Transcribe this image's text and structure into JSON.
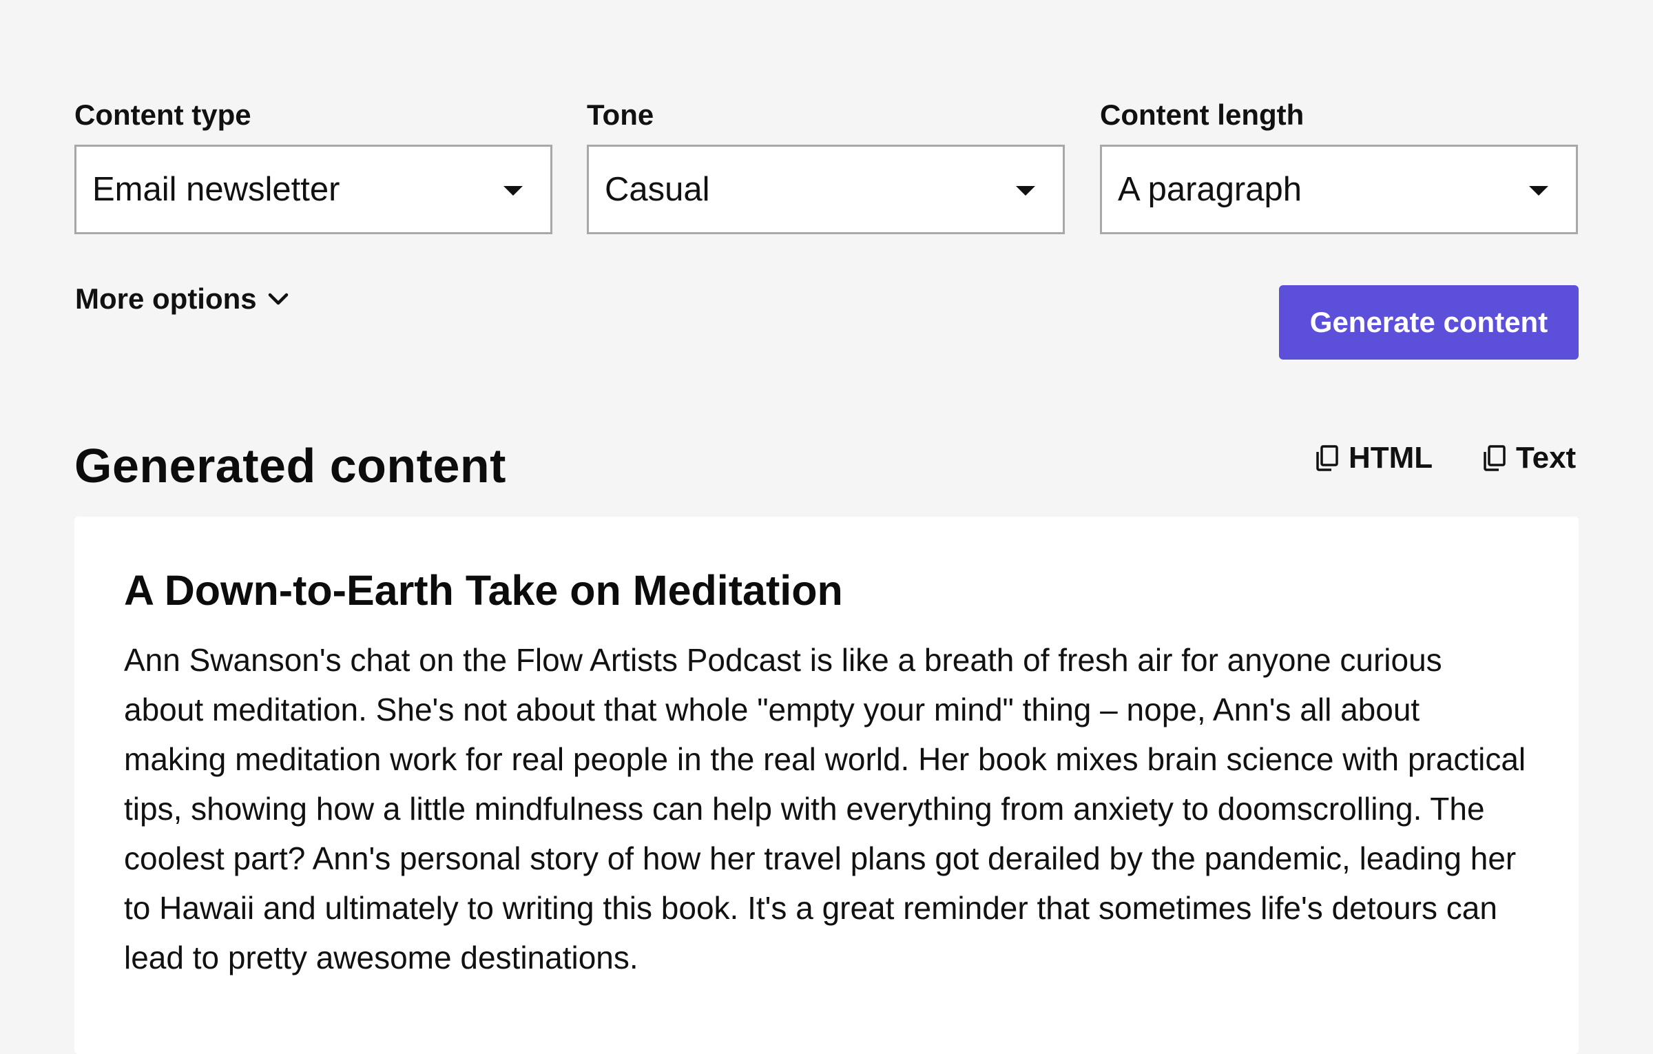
{
  "form": {
    "content_type": {
      "label": "Content type",
      "value": "Email newsletter"
    },
    "tone": {
      "label": "Tone",
      "value": "Casual"
    },
    "content_length": {
      "label": "Content length",
      "value": "A paragraph"
    },
    "more_options_label": "More options",
    "generate_label": "Generate content"
  },
  "colors": {
    "background": "#f5f5f5",
    "accent": "#5c4fd9",
    "card": "#ffffff",
    "border": "#a8a8a8"
  },
  "output": {
    "section_title": "Generated content",
    "copy_html_label": "HTML",
    "copy_text_label": "Text",
    "copy_icon": "copy-icon",
    "article_title": "A Down-to-Earth Take on Meditation",
    "article_body": "Ann Swanson's chat on the Flow Artists Podcast is like a breath of fresh air for anyone curious about meditation. She's not about that whole \"empty your mind\" thing – nope, Ann's all about making meditation work for real people in the real world. Her book mixes brain science with practical tips, showing how a little mindfulness can help with everything from anxiety to doomscrolling. The coolest part? Ann's personal story of how her travel plans got derailed by the pandemic, leading her to Hawaii and ultimately to writing this book. It's a great reminder that sometimes life's detours can lead to pretty awesome destinations."
  }
}
